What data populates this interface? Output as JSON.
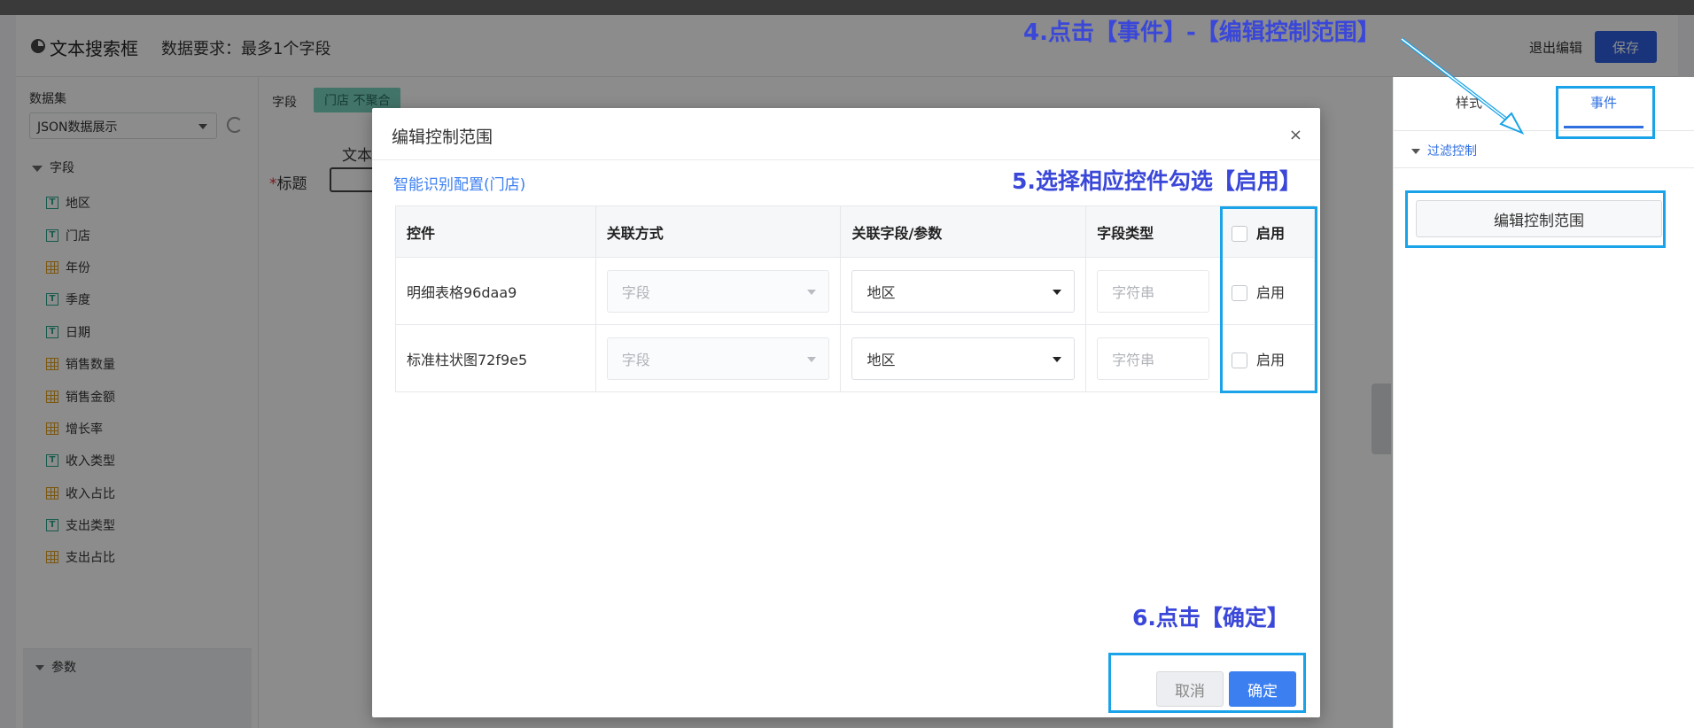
{
  "app": {
    "title": "文本搜索框",
    "data_requirement": "数据要求：最多1个字段",
    "exit_edit_label": "退出编辑",
    "save_label": "保存"
  },
  "left_panel": {
    "dataset_label": "数据集",
    "dataset_value": "JSON数据展示",
    "fields_group_label": "字段",
    "fields": [
      {
        "label": "地区",
        "type": "text"
      },
      {
        "label": "门店",
        "type": "text"
      },
      {
        "label": "年份",
        "type": "number"
      },
      {
        "label": "季度",
        "type": "text"
      },
      {
        "label": "日期",
        "type": "text"
      },
      {
        "label": "销售数量",
        "type": "number"
      },
      {
        "label": "销售金额",
        "type": "number"
      },
      {
        "label": "增长率",
        "type": "number"
      },
      {
        "label": "收入类型",
        "type": "text"
      },
      {
        "label": "收入占比",
        "type": "number"
      },
      {
        "label": "支出类型",
        "type": "text"
      },
      {
        "label": "支出占比",
        "type": "number"
      }
    ],
    "params_label": "参数"
  },
  "center": {
    "field_label": "字段",
    "field_chip": "门店 不聚合",
    "doc_text": "文本",
    "title_label": "标题",
    "required_mark": "*"
  },
  "right_panel": {
    "tab_style": "样式",
    "tab_event": "事件",
    "section_label": "过滤控制",
    "edit_range_button": "编辑控制范围"
  },
  "modal": {
    "title": "编辑控制范围",
    "close_glyph": "×",
    "smart_link": "智能识别配置(门店)",
    "columns": [
      "控件",
      "关联方式",
      "关联字段/参数",
      "字段类型",
      "启用"
    ],
    "rows": [
      {
        "control": "明细表格96daa9",
        "relation": "字段",
        "field": "地区",
        "field_type": "字符串",
        "enable": "启用"
      },
      {
        "control": "标准柱状图72f9e5",
        "relation": "字段",
        "field": "地区",
        "field_type": "字符串",
        "enable": "启用"
      }
    ],
    "cancel_label": "取消",
    "ok_label": "确定"
  },
  "annotations": {
    "step4": "4.点击【事件】-【编辑控制范围】",
    "step5": "5.选择相应控件勾选【启用】",
    "step6": "6.点击【确定】"
  },
  "colors": {
    "primary": "#3c7ff0",
    "save_button": "#2f5fe0",
    "annotation_text": "#3a47d8",
    "annotation_box": "#1aa3e8",
    "field_text_icon": "#2aa58a",
    "field_number_icon": "#e0a020"
  }
}
